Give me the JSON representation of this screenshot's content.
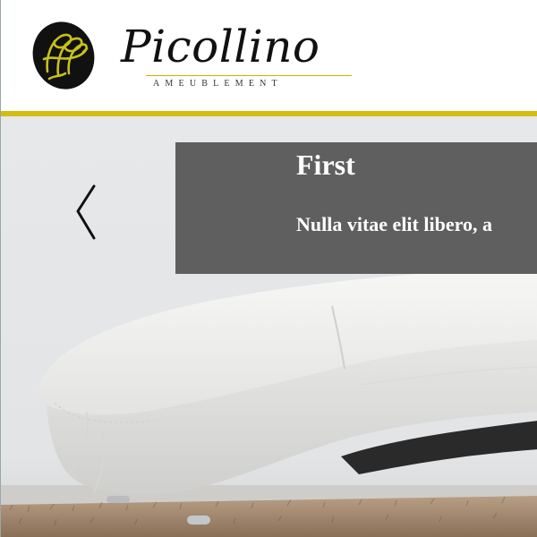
{
  "header": {
    "brand_name": "Picollino",
    "brand_tagline": "AMEUBLEMENT",
    "accent_color": "#d4bd12",
    "emblem_color": "#c7c21a"
  },
  "carousel": {
    "slides": [
      {
        "title": "First",
        "text": "Nulla vitae elit libero, a"
      }
    ],
    "prev_icon": "chevron-left-icon"
  }
}
